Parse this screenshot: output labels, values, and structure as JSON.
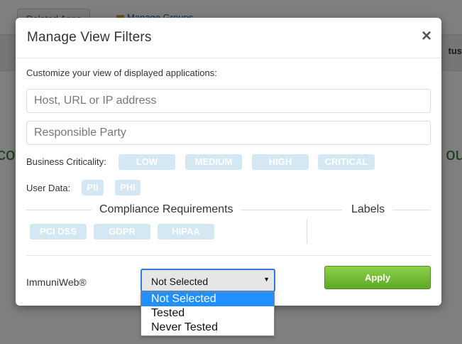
{
  "background": {
    "tab_deleted": "Deleted Apps",
    "link_groups": "Manage Groups",
    "column_header": "tus",
    "green_left": "co",
    "green_right": "ou"
  },
  "modal": {
    "title": "Manage View Filters",
    "close_label": "×",
    "intro": "Customize your view of displayed applications:",
    "host_placeholder": "Host, URL or IP address",
    "party_placeholder": "Responsible Party",
    "criticality_label": "Business Criticality:",
    "criticality": [
      "LOW",
      "MEDIUM",
      "HIGH",
      "CRITICAL"
    ],
    "userdata_label": "User Data:",
    "userdata": [
      "PII",
      "PHI"
    ],
    "compliance_title": "Compliance Requirements",
    "labels_title": "Labels",
    "compliance": [
      "PCI DSS",
      "GDPR",
      "HIPAA"
    ],
    "immuniweb_label": "ImmuniWeb®",
    "immuniweb_selected": "Not Selected",
    "immuniweb_options": [
      "Not Selected",
      "Tested",
      "Never Tested"
    ],
    "apply_label": "Apply"
  },
  "colors": {
    "pill_bg": "#d4e8f3",
    "apply_green": "#6cbf32",
    "select_focus": "#2f7bd6",
    "option_highlight": "#1e90ff"
  }
}
